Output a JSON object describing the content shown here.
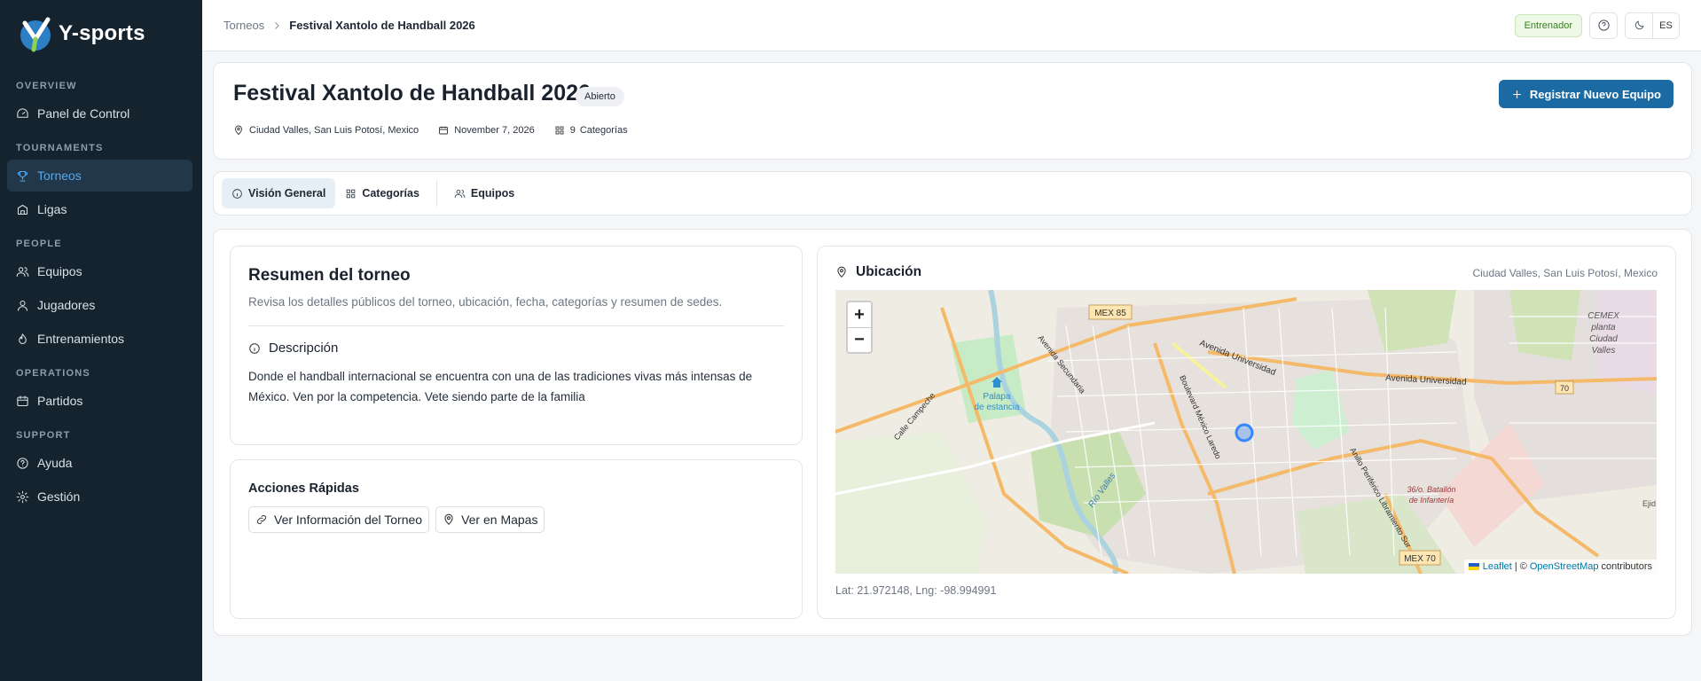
{
  "app": {
    "brand": "Y-sports"
  },
  "sidebar": {
    "sections": [
      {
        "label": "OVERVIEW",
        "items": [
          {
            "label": "Panel de Control",
            "icon": "dashboard-icon"
          }
        ]
      },
      {
        "label": "TOURNAMENTS",
        "items": [
          {
            "label": "Torneos",
            "icon": "trophy-icon",
            "active": true
          },
          {
            "label": "Ligas",
            "icon": "league-icon"
          }
        ]
      },
      {
        "label": "PEOPLE",
        "items": [
          {
            "label": "Equipos",
            "icon": "team-icon"
          },
          {
            "label": "Jugadores",
            "icon": "user-icon"
          },
          {
            "label": "Entrenamientos",
            "icon": "training-icon"
          }
        ]
      },
      {
        "label": "OPERATIONS",
        "items": [
          {
            "label": "Partidos",
            "icon": "calendar-icon"
          }
        ]
      },
      {
        "label": "SUPPORT",
        "items": [
          {
            "label": "Ayuda",
            "icon": "help-icon"
          },
          {
            "label": "Gestión",
            "icon": "gear-icon"
          }
        ]
      }
    ]
  },
  "topbar": {
    "breadcrumb_root": "Torneos",
    "breadcrumb_current": "Festival Xantolo de Handball 2026",
    "role": "Entrenador",
    "language": "ES"
  },
  "header": {
    "title": "Festival Xantolo de Handball 2026",
    "status": "Abierto",
    "location": "Ciudad Valles, San Luis Potosí, Mexico",
    "date": "November 7, 2026",
    "categories_count": "9",
    "categories_label": "Categorías",
    "register_button": "Registrar Nuevo Equipo"
  },
  "tabs": [
    {
      "label": "Visión General",
      "active": true
    },
    {
      "label": "Categorías"
    },
    {
      "label": "Equipos"
    }
  ],
  "summary": {
    "title": "Resumen del torneo",
    "subtitle": "Revisa los detalles públicos del torneo, ubicación, fecha, categorías y resumen de sedes.",
    "description_heading": "Descripción",
    "description": "Donde el handball internacional se encuentra con una de las tradiciones vivas más intensas de México. Ven por la competencia. Vete siendo parte de la familia"
  },
  "actions": {
    "title": "Acciones Rápidas",
    "view_info": "Ver Información del Torneo",
    "view_maps": "Ver en Mapas"
  },
  "map": {
    "title": "Ubicación",
    "location": "Ciudad Valles, San Luis Potosí, Mexico",
    "zoom_in": "+",
    "zoom_out": "−",
    "attribution_leaflet": "Leaflet",
    "attribution_sep": "| ©",
    "attribution_osm": "OpenStreetMap",
    "attribution_tail": "contributors",
    "coords": "Lat: 21.972148, Lng: -98.994991",
    "labels": {
      "mex85": "MEX 85",
      "mex70": "MEX 70",
      "route70": "70",
      "av_universidad_1": "Avenida Universidad",
      "av_universidad_2": "Avenida Universidad",
      "av_secundaria": "Avenida Secundaria",
      "blvd_mexico_laredo": "Boulevard México Laredo",
      "calle_campeche": "Calle Campeche",
      "rio_valles": "Río Valles",
      "anillo": "Anillo Periférico Libramiento Sur",
      "palapa_1": "Palapa",
      "palapa_2": "de estancia",
      "cemex_1": "CEMEX",
      "cemex_2": "planta",
      "cemex_3": "Ciudad",
      "cemex_4": "Valles",
      "batallon_1": "36/o. Batallón",
      "batallon_2": "de Infantería",
      "ejido": "Ejid"
    }
  },
  "colors": {
    "sidebar_bg": "#15232f",
    "accent": "#56a8ec",
    "primary_button": "#1c6aa3",
    "role_badge": "#3b7d23"
  }
}
